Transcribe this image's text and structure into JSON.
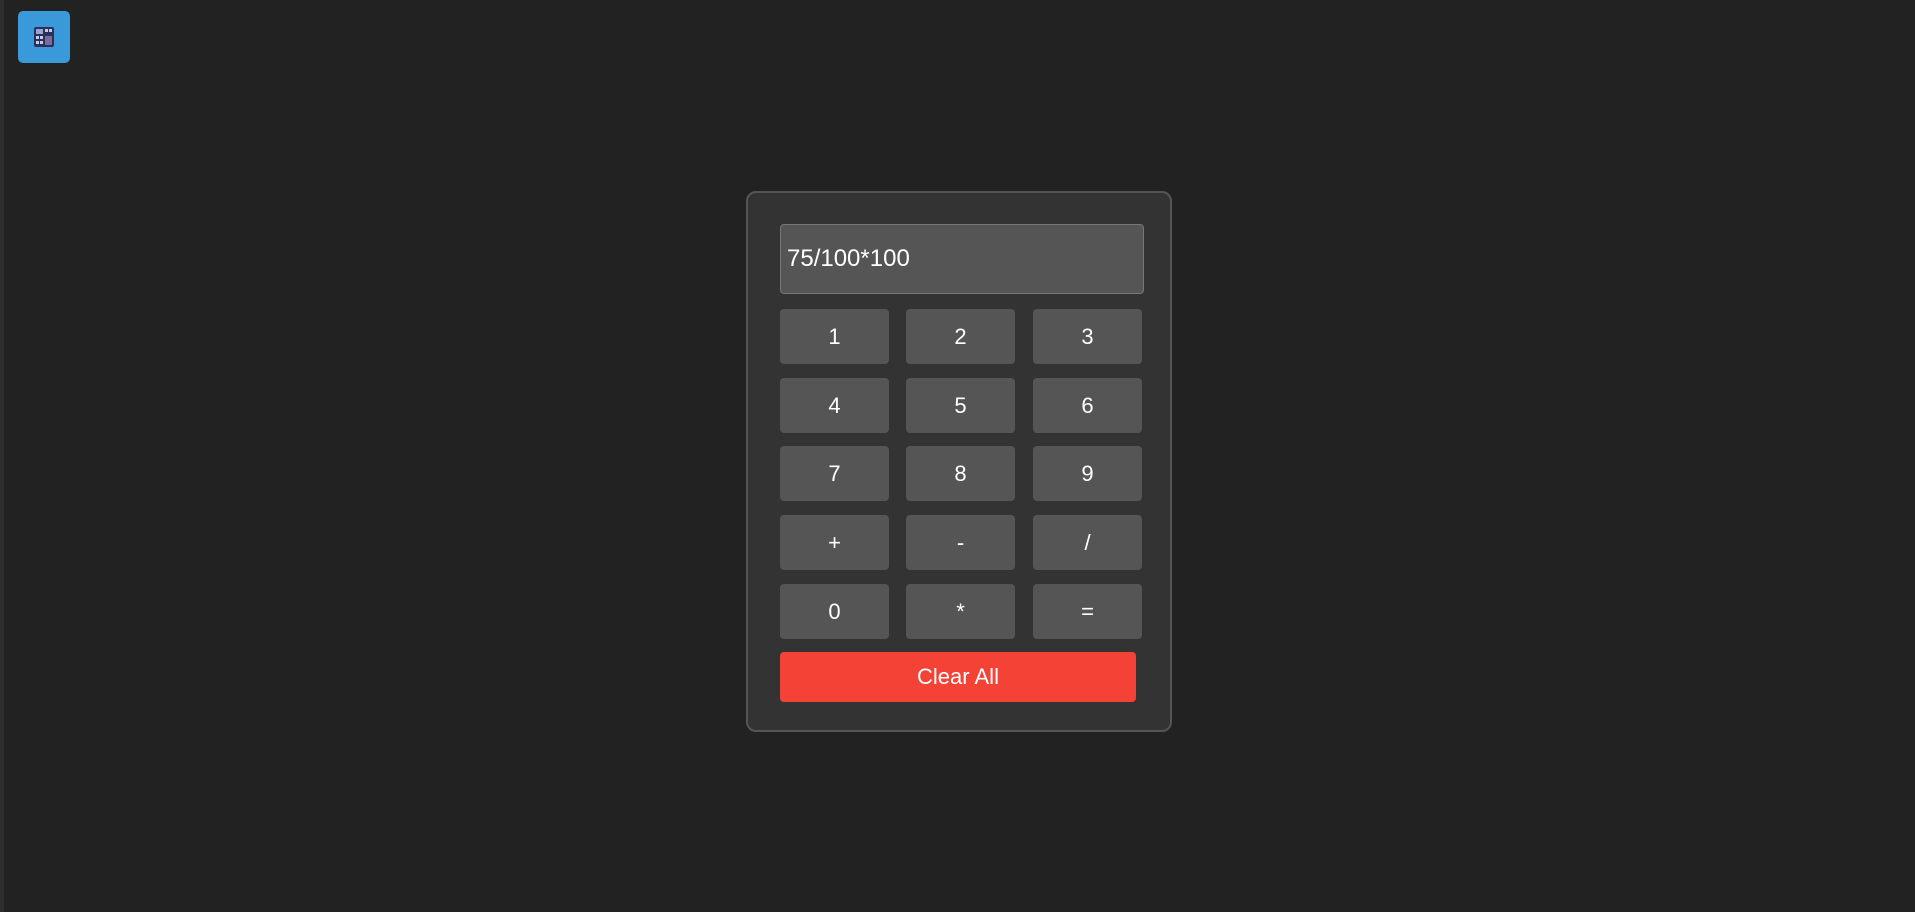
{
  "app": {
    "icon": "calculator-app-icon",
    "accent_color": "#3a9ad9"
  },
  "calculator": {
    "display_value": "75/100*100",
    "keys": {
      "one": "1",
      "two": "2",
      "three": "3",
      "four": "4",
      "five": "5",
      "six": "6",
      "seven": "7",
      "eight": "8",
      "nine": "9",
      "plus": "+",
      "minus": "-",
      "divide": "/",
      "zero": "0",
      "multiply": "*",
      "equals": "="
    },
    "clear_label": "Clear All",
    "clear_color": "#f44336"
  }
}
